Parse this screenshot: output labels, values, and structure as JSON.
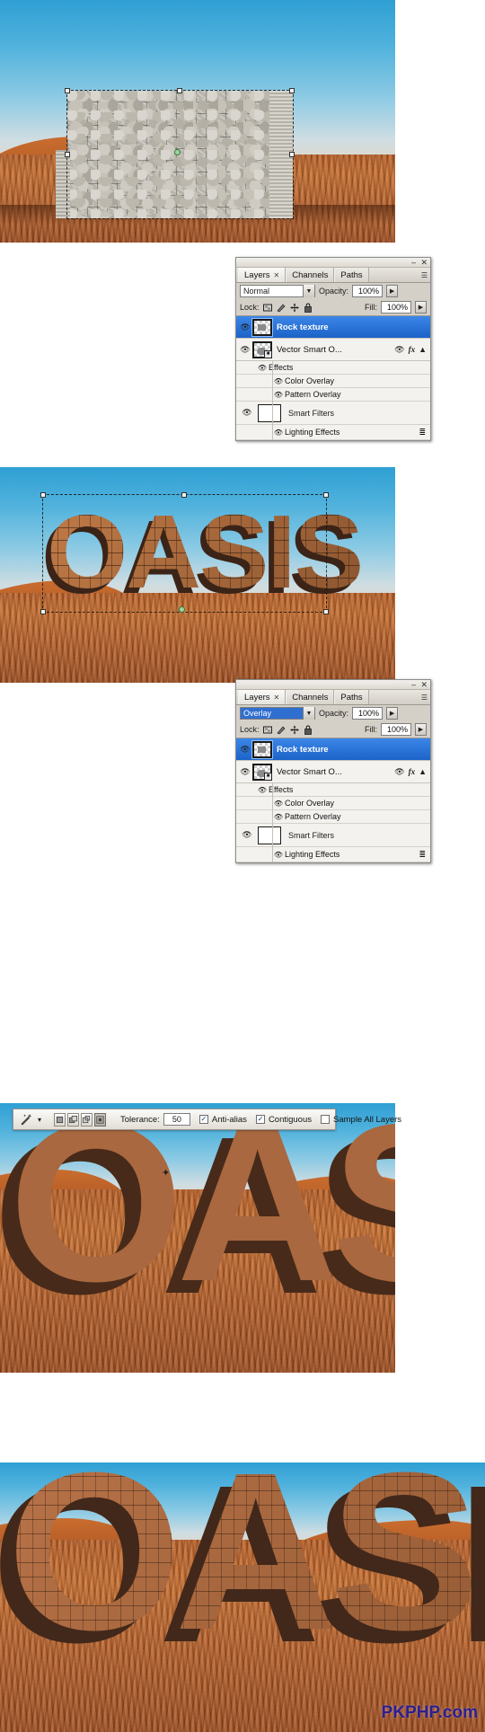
{
  "app": "Adobe Photoshop",
  "watermark": "PKPHP.com",
  "panel1": {
    "tabs": [
      {
        "label": "Layers",
        "closable": true,
        "active": true
      },
      {
        "label": "Channels",
        "closable": false,
        "active": false
      },
      {
        "label": "Paths",
        "closable": false,
        "active": false
      }
    ],
    "titlebar": {
      "minimize": "–",
      "close": "✕",
      "menu": "☰"
    },
    "blend_mode": "Normal",
    "opacity_label": "Opacity:",
    "opacity_value": "100%",
    "lock_label": "Lock:",
    "fill_label": "Fill:",
    "fill_value": "100%",
    "lock_icons": [
      "lock-transparent-icon",
      "lock-image-icon",
      "lock-position-icon",
      "lock-all-icon"
    ],
    "layers": [
      {
        "name": "Rock texture",
        "selected": true,
        "visible": true,
        "type": "raster"
      },
      {
        "name": "Vector Smart O...",
        "selected": false,
        "visible": true,
        "type": "smart-object",
        "has_fx": true
      }
    ],
    "effects_group": "Effects",
    "effects": [
      "Color Overlay",
      "Pattern Overlay"
    ],
    "smart_filters_label": "Smart Filters",
    "smart_filters": [
      "Lighting Effects"
    ]
  },
  "panel2": {
    "tabs": [
      {
        "label": "Layers",
        "closable": true,
        "active": true
      },
      {
        "label": "Channels",
        "closable": false,
        "active": false
      },
      {
        "label": "Paths",
        "closable": false,
        "active": false
      }
    ],
    "titlebar": {
      "minimize": "–",
      "close": "✕",
      "menu": "☰"
    },
    "blend_mode": "Overlay",
    "blend_mode_highlighted": true,
    "opacity_label": "Opacity:",
    "opacity_value": "100%",
    "lock_label": "Lock:",
    "fill_label": "Fill:",
    "fill_value": "100%",
    "layers": [
      {
        "name": "Rock texture",
        "selected": true,
        "visible": true,
        "type": "raster"
      },
      {
        "name": "Vector Smart O...",
        "selected": false,
        "visible": true,
        "type": "smart-object",
        "has_fx": true
      }
    ],
    "effects_group": "Effects",
    "effects": [
      "Color Overlay",
      "Pattern Overlay"
    ],
    "smart_filters_label": "Smart Filters",
    "smart_filters": [
      "Lighting Effects"
    ]
  },
  "options_bar": {
    "tool_icon": "magic-wand-icon",
    "tool_preset_arrow": "▾",
    "selection_modes": [
      "new-selection",
      "add-to-selection",
      "subtract-from-selection",
      "intersect-with-selection"
    ],
    "active_selection_mode": 3,
    "tolerance_label": "Tolerance:",
    "tolerance_value": "50",
    "checkboxes": [
      {
        "label": "Anti-alias",
        "checked": true
      },
      {
        "label": "Contiguous",
        "checked": true
      },
      {
        "label": "Sample All Layers",
        "checked": false
      }
    ]
  },
  "mini_layer_bar": {
    "layer_name": "Vector Smart...",
    "visible": true,
    "selected": true,
    "icons": [
      "mask-link-icon",
      "fx-icon",
      "expand-arrow-icon"
    ]
  },
  "canvases": [
    {
      "id": "canvas-1",
      "description": "Desert dunes photo with grey stone-wall texture layer placed and free-transform handles active",
      "artwork_text": ""
    },
    {
      "id": "canvas-2",
      "description": "Desert photo with stone-texture OASIS 3D extruded text, overlay blend, transform bounding box",
      "artwork_text": "OASIS"
    },
    {
      "id": "canvas-3",
      "description": "Close-up of flat brown OASIS 3D text with marching-ants selection from magic wand",
      "artwork_text": "OASIS"
    },
    {
      "id": "canvas-4",
      "description": "Desert photo with rock-textured OASIS 3D text and active selection",
      "artwork_text": "OASIS"
    }
  ],
  "colors": {
    "sky_top": "#2f9fd4",
    "sky_bottom": "#e8d6c4",
    "sand": "#b55c26",
    "panel_bg": "#d4d0c8",
    "layer_selected": "#1c63c8",
    "text_front": "#a9683f",
    "text_side": "#4e2d1c",
    "watermark": "#2b1f91"
  }
}
